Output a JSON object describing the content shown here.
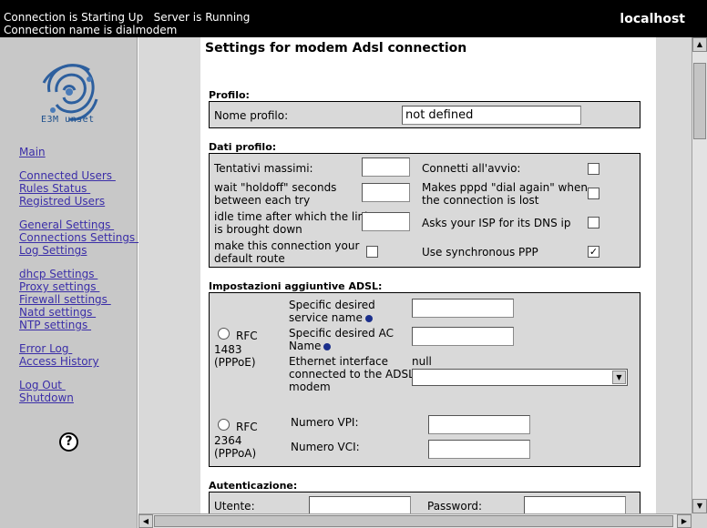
{
  "topbar": {
    "status_line1": "Connection is Starting Up   Server is Running",
    "status_line2": "Connection name is dialmodem",
    "host": "localhost"
  },
  "sidebar": {
    "logo_text": "E3M unset",
    "links": {
      "main": "Main",
      "connected_users": "Connected Users ",
      "rules_status": "Rules Status ",
      "registred_users": "Registred Users",
      "general_settings": "General Settings ",
      "connections_settings": "Connections Settings ",
      "log_settings": "Log Settings",
      "dhcp_settings": "dhcp Settings ",
      "proxy_settings": "Proxy settings ",
      "firewall_settings": "Firewall settings ",
      "natd_settings": "Natd settings ",
      "ntp_settings": "NTP settings ",
      "error_log": "Error Log ",
      "access_history": "Access History",
      "log_out": "Log Out ",
      "shutdown": "Shutdown"
    },
    "help_glyph": "?"
  },
  "page": {
    "title": "Settings for modem Adsl connection"
  },
  "profilo": {
    "section": "Profilo:",
    "nome_label": "Nome profilo:",
    "nome_value": "not defined"
  },
  "dati": {
    "section": "Dati profilo:",
    "tentativi_label": "Tentativi massimi:",
    "holdoff_label_1": "wait \"holdoff\" seconds",
    "holdoff_label_2": "between each try",
    "idle_label_1": "idle time after which the link",
    "idle_label_2": "is brought down",
    "default_route_label_1": "make this connection your",
    "default_route_label_2": "default route",
    "connetti_label": "Connetti all'avvio:",
    "dial_again_label_1": "Makes pppd \"dial again\" when",
    "dial_again_label_2": "the connection is lost",
    "dns_label": "Asks your ISP for its DNS ip",
    "sync_ppp_label": "Use synchronous PPP",
    "sync_ppp_check": "✓"
  },
  "adsl": {
    "section": "Impostazioni aggiuntive ADSL:",
    "rfc1483_line1": "RFC",
    "rfc1483_line2": "1483",
    "rfc1483_line3": "(PPPoE)",
    "service_name_label_1": "Specific desired",
    "service_name_label_2": "service name",
    "ac_name_label_1": "Specific desired AC",
    "ac_name_label_2": "Name",
    "eth_label_1": "Ethernet interface",
    "eth_label_2": "connected to the ADSL",
    "eth_label_3": "modem",
    "eth_value": "null",
    "rfc2364_line1": "RFC",
    "rfc2364_line2": "2364",
    "rfc2364_line3": "(PPPoA)",
    "vpi_label": "Numero VPI:",
    "vci_label": "Numero VCI:"
  },
  "auth": {
    "section": "Autenticazione:",
    "utente_label": "Utente:",
    "password_label": "Password:"
  },
  "colors": {
    "link": "#3b2ea8",
    "topbar_bg": "#000000",
    "panel_bg": "#d9d9d9",
    "sidebar_bg": "#c8c8c8"
  }
}
